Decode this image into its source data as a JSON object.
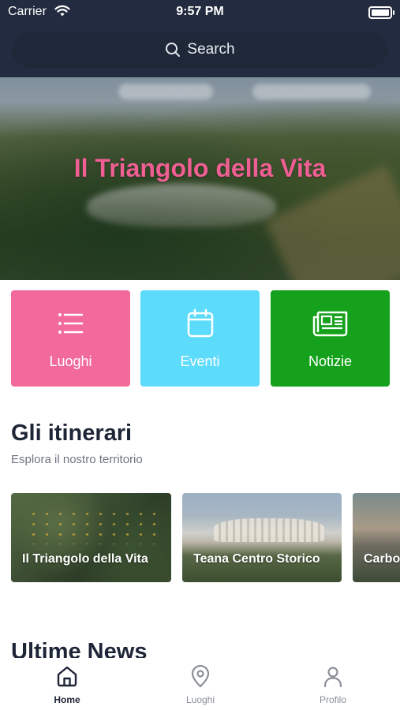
{
  "status_bar": {
    "carrier": "Carrier",
    "time": "9:57 PM"
  },
  "search": {
    "label": "Search"
  },
  "hero": {
    "title": "Il Triangolo della Vita"
  },
  "categories": [
    {
      "label": "Luoghi",
      "icon": "list-icon",
      "color": "#f26a9c"
    },
    {
      "label": "Eventi",
      "icon": "calendar-icon",
      "color": "#5ddbfb"
    },
    {
      "label": "Notizie",
      "icon": "newspaper-icon",
      "color": "#15a11b"
    }
  ],
  "itineraries": {
    "title": "Gli itinerari",
    "subtitle": "Esplora il nostro territorio",
    "items": [
      {
        "label": "Il Triangolo della Vita"
      },
      {
        "label": "Teana Centro Storico"
      },
      {
        "label": "Carbone"
      }
    ]
  },
  "news": {
    "title": "Ultime News"
  },
  "tabs": [
    {
      "label": "Home",
      "icon": "home-icon",
      "active": true
    },
    {
      "label": "Luoghi",
      "icon": "map-pin-icon",
      "active": false
    },
    {
      "label": "Profilo",
      "icon": "user-icon",
      "active": false
    }
  ],
  "colors": {
    "header_bg": "#222b3f",
    "hero_title": "#ef5f93",
    "text_dark": "#1e2537"
  }
}
